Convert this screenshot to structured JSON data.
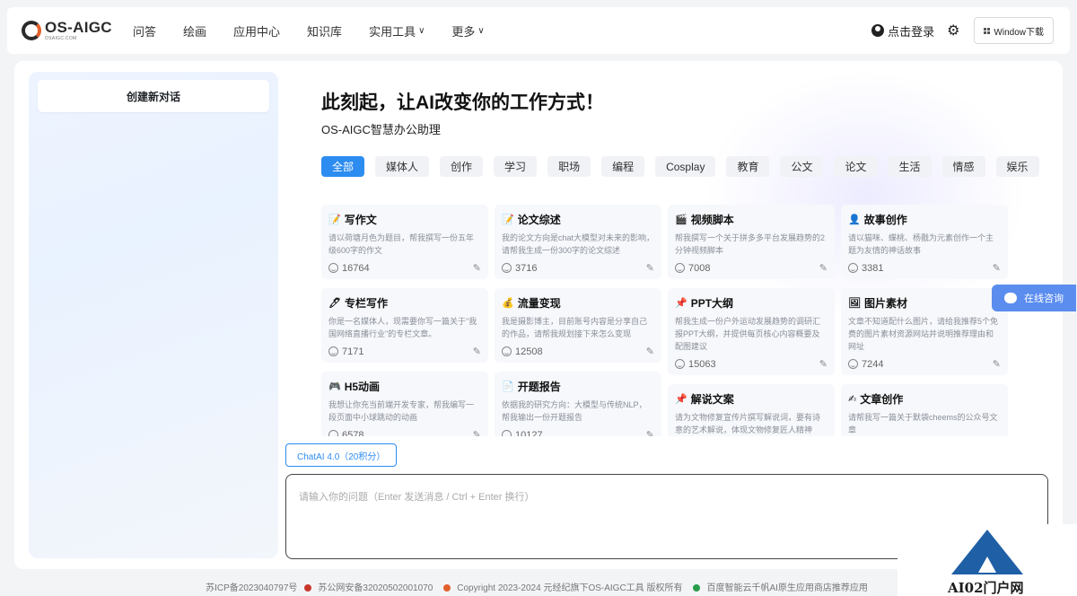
{
  "brand": {
    "name": "OS-AIGC",
    "sub": "OSAIGC.COM"
  },
  "nav": [
    {
      "label": "问答",
      "chevron": false
    },
    {
      "label": "绘画",
      "chevron": false
    },
    {
      "label": "应用中心",
      "chevron": false
    },
    {
      "label": "知识库",
      "chevron": false
    },
    {
      "label": "实用工具",
      "chevron": true
    },
    {
      "label": "更多",
      "chevron": true
    }
  ],
  "header": {
    "login": "点击登录",
    "download": "Window下载"
  },
  "sidebar": {
    "new_chat": "创建新对话"
  },
  "hero": {
    "title": "此刻起，让AI改变你的工作方式！",
    "subtitle": "OS-AIGC智慧办公助理"
  },
  "tags": [
    "全部",
    "媒体人",
    "创作",
    "学习",
    "职场",
    "编程",
    "Cosplay",
    "教育",
    "公文",
    "论文",
    "生活",
    "情感",
    "娱乐"
  ],
  "cards": [
    [
      {
        "icon": "📝",
        "title": "写作文",
        "desc": "请以荷塘月色为题目，帮我撰写一份五年级600字的作文",
        "count": "16764"
      },
      {
        "icon": "🖊",
        "title": "专栏写作",
        "desc": "你是一名媒体人，现需要你写一篇关于\"我国网络直播行业\"的专栏文章。",
        "count": "7171"
      },
      {
        "icon": "🎮",
        "title": "H5动画",
        "desc": "我想让你充当前端开发专家，帮我编写一段页面中小球跳动的动画",
        "count": "6578"
      }
    ],
    [
      {
        "icon": "📝",
        "title": "论文综述",
        "desc": "我的论文方向是chat大模型对未来的影响，请帮我生成一份300字的论文综述",
        "count": "3716"
      },
      {
        "icon": "💰",
        "title": "流量变现",
        "desc": "我是摄影博主，目前账号内容是分享自己的作品，请帮我规划接下来怎么变现",
        "count": "12508"
      },
      {
        "icon": "📄",
        "title": "开题报告",
        "desc": "依据我的研究方向：大模型与传统NLP，帮我输出一份开题报告",
        "count": "10127"
      }
    ],
    [
      {
        "icon": "🎬",
        "title": "视频脚本",
        "desc": "帮我撰写一个关于拼多多平台发展趋势的2分钟视频脚本",
        "count": "7008"
      },
      {
        "icon": "📌",
        "title": "PPT大纲",
        "desc": "帮我生成一份户外运动发展趋势的调研汇报PPT大纲，并提供每页核心内容概要及配图建议",
        "count": "15063"
      },
      {
        "icon": "📌",
        "title": "解说文案",
        "desc": "请为文物修复宣传片撰写解说词，要有诗意的艺术解说，体现文物修复匠人精神",
        "count": ""
      }
    ],
    [
      {
        "icon": "👤",
        "title": "故事创作",
        "desc": "请以猫咪、蝶桃、杨戬为元素创作一个主题为友情的神话故事",
        "count": "3381"
      },
      {
        "icon": "🖼",
        "title": "图片素材",
        "desc": "文章不知道配什么图片，请给我推荐5个免费的图片素材资源网站并说明推荐理由和网址",
        "count": "7244"
      },
      {
        "icon": "✍",
        "title": "文章创作",
        "desc": "请帮我写一篇关于默袋cheems的公众号文章",
        "count": ""
      }
    ]
  ],
  "composer": {
    "model": "ChatAI 4.0（20积分）",
    "placeholder": "请输入你的问题（Enter 发送消息 / Ctrl + Enter 换行）"
  },
  "consult": "在线咨询",
  "footer": {
    "icp": "苏ICP备2023040797号",
    "police": "苏公网安备32020502001070",
    "copyright": "Copyright 2023-2024 元经纪旗下OS-AIGC工具 版权所有",
    "partner": "百度智能云千帆AI原生应用商店推荐应用"
  },
  "watermark": "AI02门户网",
  "colors": {
    "accent": "#2d8cf0",
    "consult": "#5b8def",
    "logo_orange": "#e2602b"
  }
}
